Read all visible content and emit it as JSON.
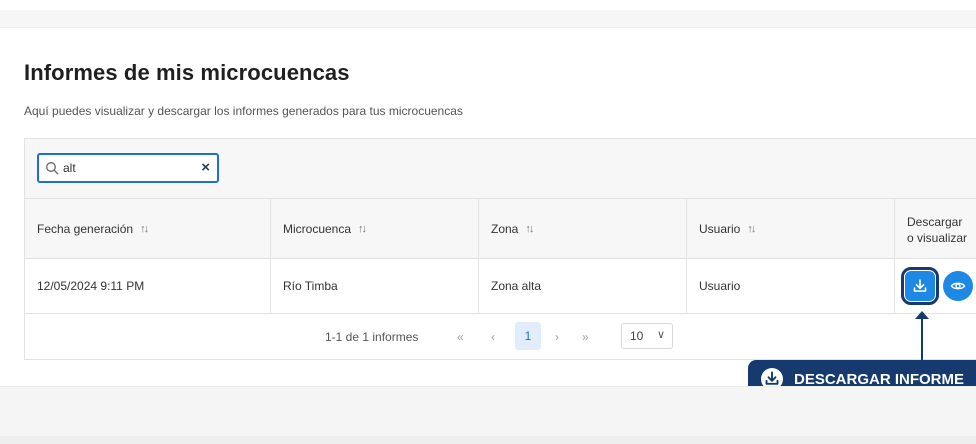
{
  "page": {
    "title": "Informes de mis microcuencas",
    "subtitle": "Aquí puedes visualizar y descargar los informes generados para tus microcuencas"
  },
  "search": {
    "value": "alt",
    "clear_icon": "×",
    "icon": "search-icon"
  },
  "table": {
    "columns": [
      {
        "label": "Fecha generación",
        "sortable": true
      },
      {
        "label": "Microcuenca",
        "sortable": true
      },
      {
        "label": "Zona",
        "sortable": true
      },
      {
        "label": "Usuario",
        "sortable": true
      },
      {
        "label": "Descargar o visualizar",
        "line1": "Descargar",
        "line2": "o visualizar",
        "sortable": false
      }
    ],
    "sort_glyph": "↑↓",
    "rows": [
      {
        "fecha": "12/05/2024 9:11 PM",
        "microcuenca": "Río Timba",
        "zona": "Zona alta",
        "usuario": "Usuario",
        "actions": [
          "download-icon",
          "eye-icon"
        ]
      }
    ]
  },
  "pagination": {
    "info": "1-1 de 1 informes",
    "first": "«",
    "prev": "‹",
    "current_page": "1",
    "next": "›",
    "last": "»",
    "page_size": "10",
    "page_size_chevron": "∨"
  },
  "callout": {
    "label": "DESCARGAR INFORME",
    "icon": "download-icon"
  },
  "colors": {
    "primary": "#1e88e5",
    "accent_dark": "#163a6e",
    "focus_border": "#1d6fd6",
    "header_bg": "#f7f7f8"
  }
}
